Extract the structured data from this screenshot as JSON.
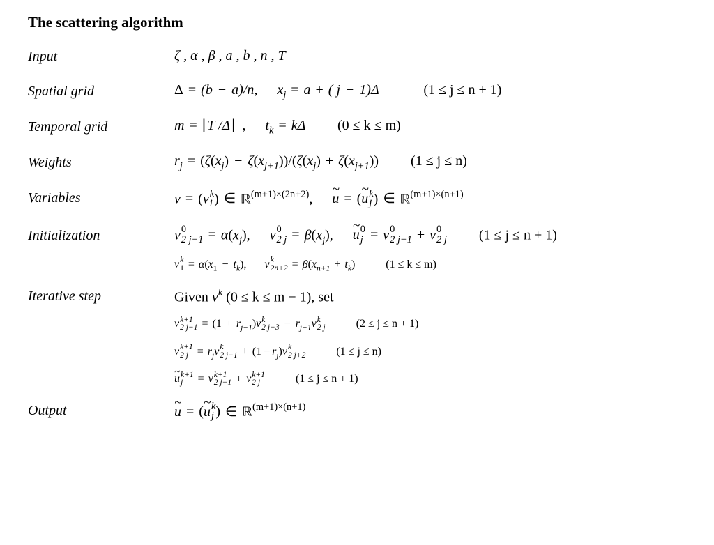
{
  "title": "The scattering algorithm",
  "rows": {
    "input": {
      "label": "Input",
      "expr": "ζ , α , β , a , b , n , T"
    },
    "spatial": {
      "label": "Spatial grid",
      "delta_lhs": "Δ",
      "delta_rhs_open": "(b",
      "delta_rhs_a": "a)/n,",
      "xj_lhs": "x",
      "xj_sub": "j",
      "xj_rhs_a": "a",
      "xj_rhs_b": "( j",
      "xj_rhs_c": "1)Δ",
      "range": "(1 ≤ j ≤ n + 1)"
    },
    "temporal": {
      "label": "Temporal grid",
      "m_lhs": "m",
      "m_rhs_inner": "T /Δ",
      "comma": ",",
      "tk_lhs": "t",
      "tk_sub": "k",
      "tk_rhs": "kΔ",
      "range": "(0 ≤ k ≤ m)"
    },
    "weights": {
      "label": "Weights",
      "r_lhs": "r",
      "r_sub": "j",
      "zeta": "ζ",
      "xj": "x",
      "xj1_sub": "j+1",
      "div": "/",
      "range": "(1 ≤ j ≤ n)"
    },
    "variables": {
      "label": "Variables",
      "v": "v",
      "vi_sub": "i",
      "vi_sup": "k",
      "R": "ℝ",
      "exp1": "(m+1)×(2n+2)",
      "u": "u",
      "uj_sub": "j",
      "uj_sup": "k",
      "exp2": "(m+1)×(n+1)"
    },
    "init": {
      "label": "Initialization",
      "line1": {
        "v": "v",
        "sub1": "2 j−1",
        "sup0": "0",
        "alpha": "α",
        "x": "x",
        "j": "j",
        "sub2": "2 j",
        "beta": "β",
        "u": "u",
        "range": "(1 ≤ j ≤ n + 1)"
      },
      "line2": {
        "v": "v",
        "sup": "k",
        "sub1": "1",
        "alpha": "α",
        "x1": "x",
        "x1sub": "1",
        "t": "t",
        "tsub": "k",
        "sub2": "2n+2",
        "beta": "β",
        "xn1": "x",
        "xn1sub": "n+1",
        "range": "(1 ≤ k ≤ m)"
      }
    },
    "iter": {
      "label": "Iterative step",
      "given": "Given ",
      "vk": "v",
      "vk_sup": "k",
      "cond": " (0 ≤ k ≤ m − 1), set",
      "eq1": {
        "v": "v",
        "sup": "k+1",
        "sub": "2 j−1",
        "one": "(1",
        "r": "r",
        "rsub": "j−1",
        "close": ")",
        "v2": "v",
        "v2sup": "k",
        "v2sub": "2 j−3",
        "v3sub": "2 j",
        "range": "(2 ≤ j ≤ n + 1)"
      },
      "eq2": {
        "v": "v",
        "sup": "k+1",
        "sub": "2 j",
        "r": "r",
        "rsub": "j",
        "v2": "v",
        "v2sup": "k",
        "v2sub": "2 j−1",
        "v3sub": "2 j+2",
        "range": "(1 ≤ j ≤ n)"
      },
      "eq3": {
        "u": "u",
        "sup": "k+1",
        "sub": "j",
        "v": "v",
        "v1sub": "2 j−1",
        "v2sub": "2 j",
        "range": "(1 ≤ j ≤ n + 1)"
      }
    },
    "output": {
      "label": "Output",
      "u": "u",
      "sub": "j",
      "sup": "k",
      "R": "ℝ",
      "exp": "(m+1)×(n+1)"
    }
  }
}
